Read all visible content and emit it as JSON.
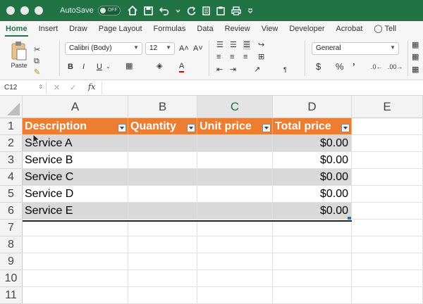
{
  "titlebar": {
    "autosave_label": "AutoSave",
    "toggle_state": "OFF"
  },
  "tabs": [
    "Home",
    "Insert",
    "Draw",
    "Page Layout",
    "Formulas",
    "Data",
    "Review",
    "View",
    "Developer",
    "Acrobat",
    "Tell"
  ],
  "ribbon": {
    "paste_label": "Paste",
    "font_name": "Calibri (Body)",
    "font_size": "12",
    "number_format": "General"
  },
  "formula_bar": {
    "cell_ref": "C12",
    "fx": "fx"
  },
  "columns": [
    "A",
    "B",
    "C",
    "D",
    "E"
  ],
  "rows": [
    "1",
    "2",
    "3",
    "4",
    "5",
    "6",
    "7",
    "8",
    "9",
    "10",
    "11"
  ],
  "table": {
    "headers": [
      "Description",
      "Quantity",
      "Unit price",
      "Total price"
    ],
    "rows": [
      {
        "description": "Service A",
        "total": "$0.00"
      },
      {
        "description": "Service B",
        "total": "$0.00"
      },
      {
        "description": "Service C",
        "total": "$0.00"
      },
      {
        "description": "Service D",
        "total": "$0.00"
      },
      {
        "description": "Service E",
        "total": "$0.00"
      }
    ]
  },
  "colors": {
    "excel_green": "#217346",
    "header_orange": "#ed7d31",
    "band_gray": "#d9d9d9"
  }
}
